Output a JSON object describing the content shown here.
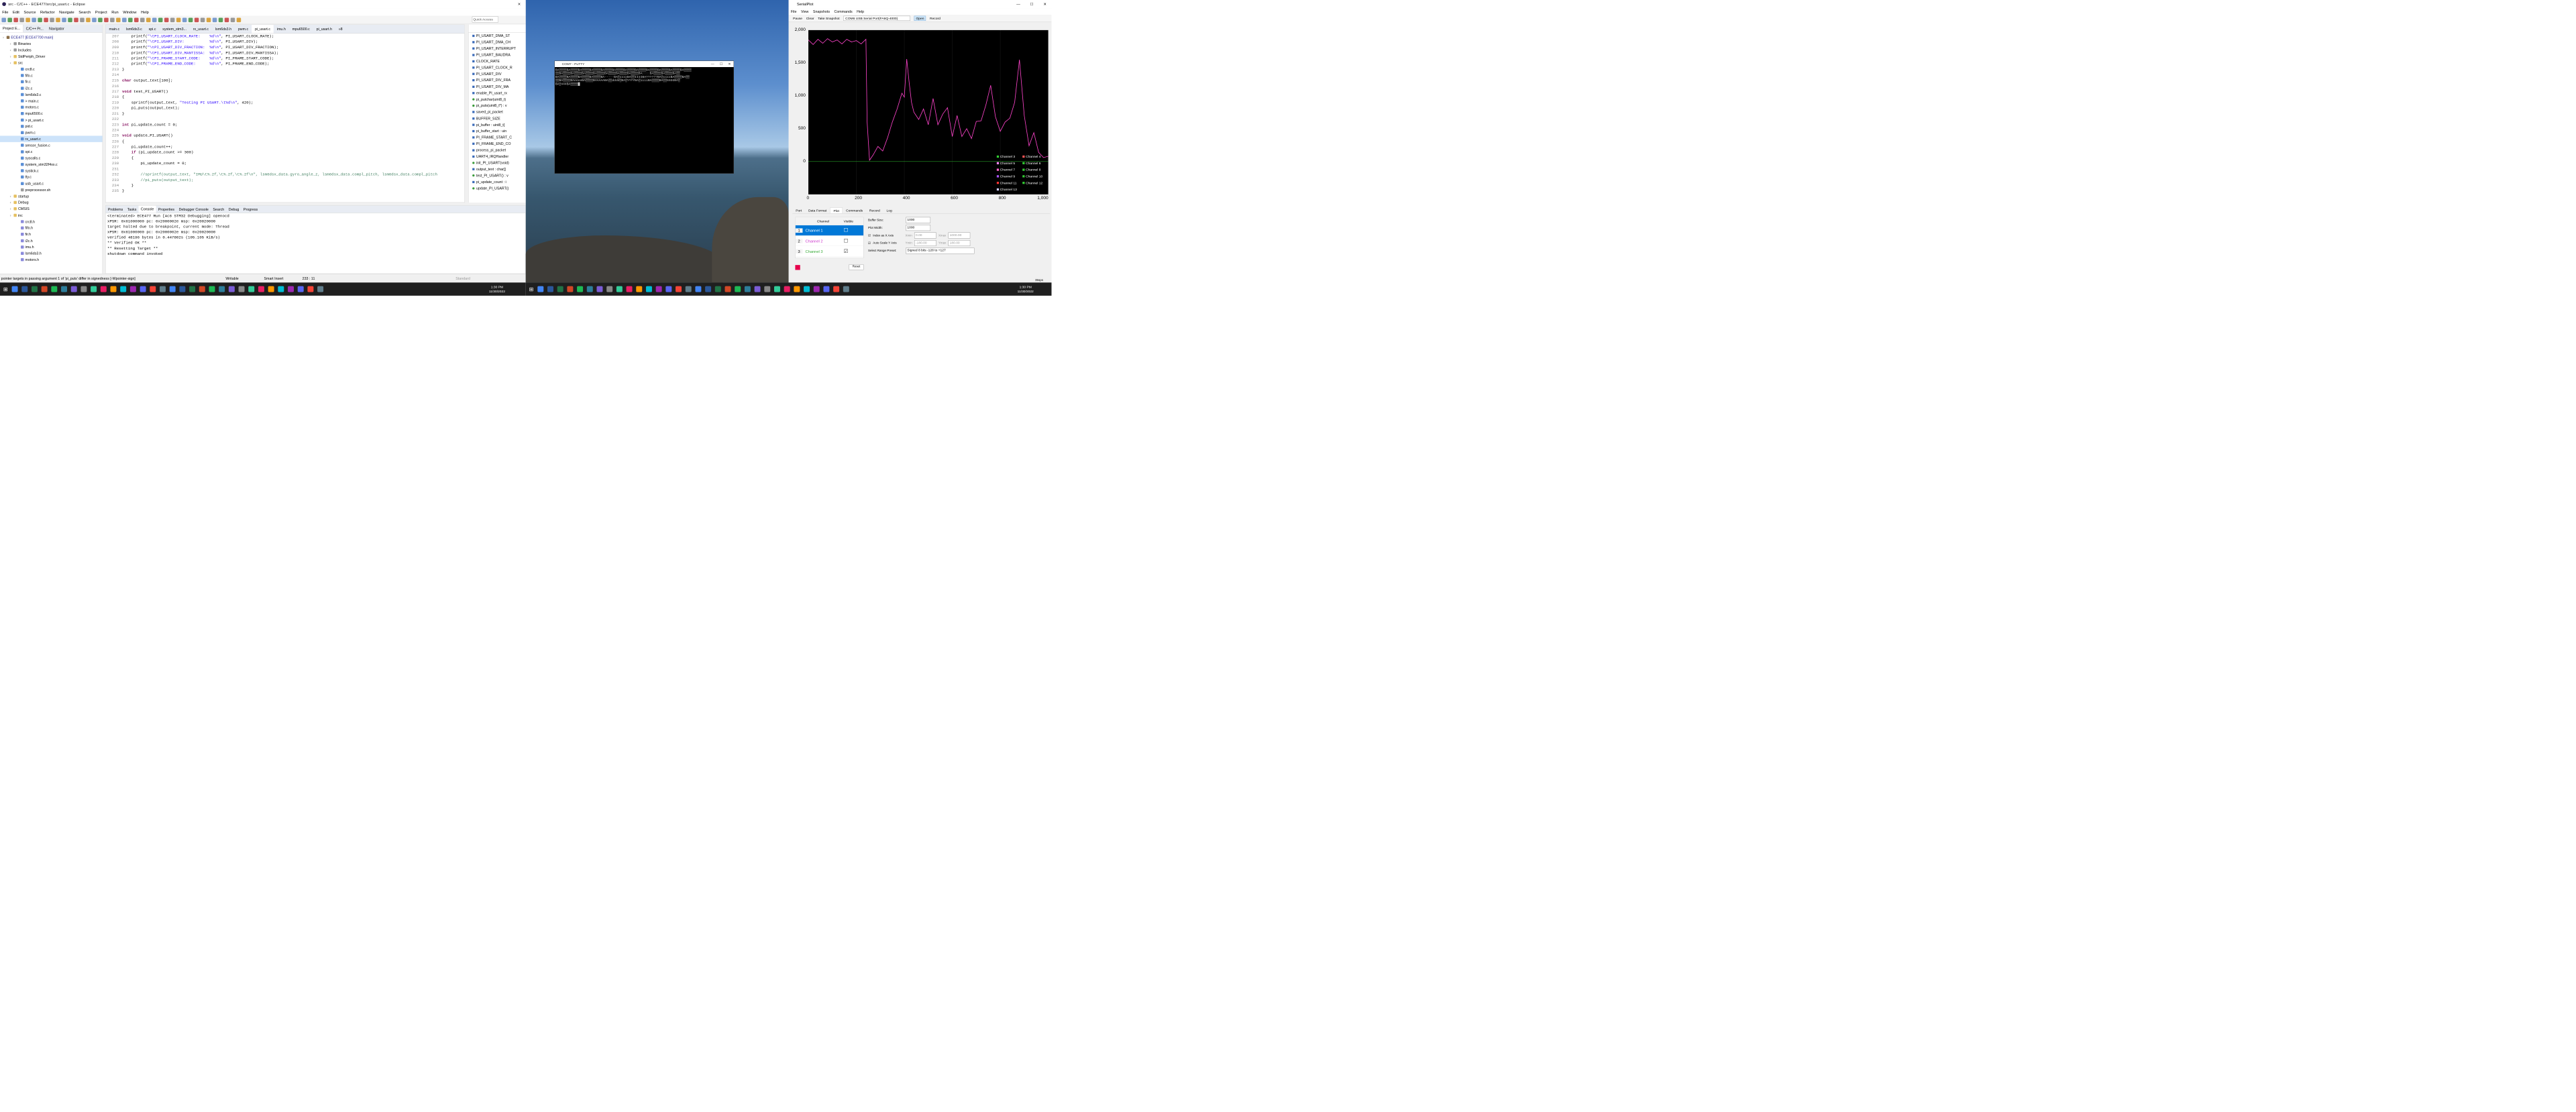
{
  "eclipse": {
    "title": "src - C/C++ - ECE477/src/pi_usart.c - Eclipse",
    "menu": [
      "File",
      "Edit",
      "Source",
      "Refactor",
      "Navigate",
      "Search",
      "Project",
      "Run",
      "Window",
      "Help"
    ],
    "quick_access": "Quick Access",
    "project_tabs": [
      "Project E...",
      "C/C++ Pr...",
      "Navigator"
    ],
    "tree": [
      {
        "label": "ECE477 [ECE47700 main]",
        "icon": "project-icon",
        "depth": 0,
        "color": "#1a1a8a"
      },
      {
        "label": "Binaries",
        "icon": "binaries-icon",
        "depth": 1
      },
      {
        "label": "Includes",
        "icon": "includes-icon",
        "depth": 1
      },
      {
        "label": "StdPeriph_Driver",
        "icon": "folder-icon",
        "depth": 1
      },
      {
        "label": "src",
        "icon": "folder-icon",
        "depth": 1
      },
      {
        "label": "crc8.c",
        "icon": "c-file-icon",
        "depth": 2
      },
      {
        "label": "fifo.c",
        "icon": "c-file-icon",
        "depth": 2
      },
      {
        "label": "fir.c",
        "icon": "c-file-icon",
        "depth": 2
      },
      {
        "label": "i2c.c",
        "icon": "c-file-icon",
        "depth": 2
      },
      {
        "label": "lsm6ds3.c",
        "icon": "c-file-icon",
        "depth": 2
      },
      {
        "label": "> main.c",
        "icon": "c-file-icon",
        "depth": 2
      },
      {
        "label": "motors.c",
        "icon": "c-file-icon",
        "depth": 2
      },
      {
        "label": "mpu6500.c",
        "icon": "c-file-icon",
        "depth": 2
      },
      {
        "label": "> pi_usart.c",
        "icon": "c-file-icon",
        "depth": 2
      },
      {
        "label": "pid.c",
        "icon": "c-file-icon",
        "depth": 2
      },
      {
        "label": "pwm.c",
        "icon": "c-file-icon",
        "depth": 2
      },
      {
        "label": "rx_usart.c",
        "icon": "c-file-icon",
        "depth": 2,
        "selected": true
      },
      {
        "label": "sensor_fusion.c",
        "icon": "c-file-icon",
        "depth": 2
      },
      {
        "label": "spi.c",
        "icon": "c-file-icon",
        "depth": 2
      },
      {
        "label": "syscalls.c",
        "icon": "c-file-icon",
        "depth": 2
      },
      {
        "label": "system_stm32f4xx.c",
        "icon": "c-file-icon",
        "depth": 2
      },
      {
        "label": "systick.c",
        "icon": "c-file-icon",
        "depth": 2
      },
      {
        "label": "tty.c",
        "icon": "c-file-icon",
        "depth": 2
      },
      {
        "label": "usb_usart.c",
        "icon": "c-file-icon",
        "depth": 2
      },
      {
        "label": "preprocessor.sh",
        "icon": "script-icon",
        "depth": 2
      },
      {
        "label": "startup",
        "icon": "folder-icon",
        "depth": 1
      },
      {
        "label": "Debug",
        "icon": "folder-icon",
        "depth": 1
      },
      {
        "label": "CMSIS",
        "icon": "folder-icon",
        "depth": 1
      },
      {
        "label": "inc",
        "icon": "folder-icon",
        "depth": 1
      },
      {
        "label": "crc8.h",
        "icon": "h-file-icon",
        "depth": 2
      },
      {
        "label": "fifo.h",
        "icon": "h-file-icon",
        "depth": 2
      },
      {
        "label": "fir.h",
        "icon": "h-file-icon",
        "depth": 2
      },
      {
        "label": "i2c.h",
        "icon": "h-file-icon",
        "depth": 2
      },
      {
        "label": "imu.h",
        "icon": "h-file-icon",
        "depth": 2
      },
      {
        "label": "lsm6ds3.h",
        "icon": "h-file-icon",
        "depth": 2
      },
      {
        "label": "motors.h",
        "icon": "h-file-icon",
        "depth": 2
      }
    ],
    "editor_tabs": [
      "main.c",
      "lsm6ds3.c",
      "spi.c",
      "system_stm3...",
      "rx_usart.c",
      "lsm6ds3.h",
      "pwm.c",
      "pi_usart.c",
      "imu.h",
      "mpu6500.c",
      "pi_usart.h",
      "»8"
    ],
    "active_tab": 7,
    "code": [
      {
        "n": "207",
        "t": "    printf(\"\\tPI_USART_CLOCK_RATE:    %d\\n\", PI_USART_CLOCK_RATE);"
      },
      {
        "n": "208",
        "t": "    printf(\"\\tPI_USART_DIV:           %d\\n\", PI_USART_DIV);"
      },
      {
        "n": "209",
        "t": "    printf(\"\\tPI_USART_DIV_FRACTION:  %d\\n\", PI_USART_DIV_FRACTION);"
      },
      {
        "n": "210",
        "t": "    printf(\"\\tPI_USART_DIV_MANTISSA:  %d\\n\", PI_USART_DIV_MANTISSA);"
      },
      {
        "n": "211",
        "t": "    printf(\"\\tPI_FRAME_START_CODE:    %d\\n\", PI_FRAME_START_CODE);"
      },
      {
        "n": "212",
        "t": "    printf(\"\\tPI_FRAME_END_CODE:      %d\\n\", PI_FRAME_END_CODE);"
      },
      {
        "n": "213",
        "t": "}"
      },
      {
        "n": "214",
        "t": ""
      },
      {
        "n": "215",
        "t": "char output_text[100];"
      },
      {
        "n": "216",
        "t": ""
      },
      {
        "n": "217",
        "t": "void test_PI_USART()"
      },
      {
        "n": "218",
        "t": "{"
      },
      {
        "n": "219",
        "t": "    sprintf(output_text, \"Testing PI USART.\\t%d\\n\", 420);"
      },
      {
        "n": "220",
        "t": "    pi_puts(output_text);"
      },
      {
        "n": "221",
        "t": "}"
      },
      {
        "n": "222",
        "t": ""
      },
      {
        "n": "223",
        "t": "int pi_update_count = 0;"
      },
      {
        "n": "224",
        "t": ""
      },
      {
        "n": "225",
        "t": "void update_PI_USART()"
      },
      {
        "n": "226",
        "t": "{"
      },
      {
        "n": "227",
        "t": "    pi_update_count++;"
      },
      {
        "n": "228",
        "t": "    if (pi_update_count >= 300)"
      },
      {
        "n": "229",
        "t": "    {"
      },
      {
        "n": "230",
        "t": "        pi_update_count = 0;"
      },
      {
        "n": "231",
        "t": ""
      },
      {
        "n": "232",
        "t": "        //sprintf(output_text, \"IMU\\t%.2f,\\t%.2f,\\t%.2f\\n\", lsm6dsx_data.gyro_angle_z, lsm6dsx_data.compl_pitch, lsm6dsx_data.compl_pitch"
      },
      {
        "n": "233",
        "t": "        //pi_puts(output_text);"
      },
      {
        "n": "234",
        "t": "    }"
      },
      {
        "n": "235",
        "t": "}"
      },
      {
        "n": "236",
        "t": ""
      }
    ],
    "outline": [
      "PI_USART_DMA_ST",
      "PI_USART_DMA_CH",
      "PI_USART_INTERRUPT",
      "PI_USART_BAUDRA",
      "CLOCK_RATE",
      "PI_USART_CLOCK_R",
      "PI_USART_DIV",
      "PI_USART_DIV_FRA",
      "PI_USART_DIV_MA",
      "enable_PI_usart_rx",
      "pi_putchar(uint8_t)",
      "pi_puts(uint8_t*) : v",
      "saved_pi_packet",
      "BUFFER_SIZE",
      "pi_buffer : uint8_t[",
      "pi_buffer_start : uin",
      "PI_FRAME_START_C",
      "PI_FRAME_END_CO",
      "process_pi_packet",
      "UART4_IRQHandler",
      "init_PI_USART(void)",
      "output_text : char[]",
      "test_PI_USART() : v",
      "pi_update_count : i",
      "update_PI_USART()"
    ],
    "console_tabs": [
      "Problems",
      "Tasks",
      "Console",
      "Properties",
      "Debugger Console",
      "Search",
      "Debug",
      "Progress"
    ],
    "console_active": 2,
    "console_lines": [
      "<terminated> ECE477 Run [Ac6 STM32 Debugging] openocd",
      "xPSR: 0x61000000 pc: 0x2000002e msp: 0x20020000",
      "target halted due to breakpoint, current mode: Thread",
      "xPSR: 0x61000000 pc: 0x2000002e msp: 0x20020000",
      "verified 48196 bytes in 0.447802s (105.105 KiB/s)",
      "** Verified OK **",
      "** Resetting Target **",
      "shutdown command invoked"
    ],
    "status": {
      "message": "pointer targets in passing argument 1 of 'pi_puts' differ in signedness [-Wpointer-sign]",
      "mode": "Writable",
      "insert": "Smart Insert",
      "pos": "233 : 11",
      "right": "Standard"
    }
  },
  "putty": {
    "title": "COM7 - PuTTY",
    "lines": [
      "BA▒▒▒▒BA▒▒▒▒BA▒▒▒▒BA▒▒▒▒BA▒▒▒▒BA▒▒▒▒BA▒▒▒▒BA▒▒▒▒BA▒▒▒▒BA▒▒▒▒BA▒▒▒▒BA▒▒▒▒",
      "▒▒BA▒▒▒▒BA▒▒▒▒BA▒▒▒▒BA▒▒▒▒BA▒▒▒▒BA▒▒▒▒BA▒▒▒▒BA::::BA▒▒▒▒BA▒▒▒▒BA▒▒",
      "BA▒▒▒▒BA▒▒▒▒BA▒▒▒▒BA▒▒▒▒BA-----BA▒xxxxBA▒▒IIIIBA??????BA▒xxxxBA▒▒▒▒BA▒▒",
      "▒▒BA▒▒▒▒BAeeeeBA▒▒▒▒BAAAAABA▒▒dddd▒BA▒YYYYBA▒iiiiBA▒▒▒▒BA▒▒GGGGBA▒",
      "BA▒444BA▒▒▒▒█"
    ]
  },
  "serialplot": {
    "title": "SerialPlot",
    "menu": [
      "File",
      "View",
      "Snapshots",
      "Commands",
      "Help"
    ],
    "toolbar": {
      "pause": "Pause",
      "clear": "Clear",
      "snapshot": "Take Snapshot",
      "port": "COM6 USB Serial Port(FA6Q-4000)",
      "open": "Open",
      "record": "Record"
    },
    "tabs": [
      "Port",
      "Data Format",
      "Plot",
      "Commands",
      "Record",
      "Log"
    ],
    "active_tab": 2,
    "channels": [
      {
        "num": "1",
        "name": "Channel 1",
        "color": "#ffffff",
        "visible": false,
        "selected": true
      },
      {
        "num": "2",
        "name": "Channel 2",
        "color": "#cc33cc",
        "visible": false,
        "selected": false
      },
      {
        "num": "3",
        "name": "Channel 3",
        "color": "#33aa33",
        "visible": true,
        "selected": false
      }
    ],
    "table_headers": [
      "Channel",
      "Visible"
    ],
    "opts": {
      "buffer_label": "Buffer Size:",
      "buffer": "1000",
      "width_label": "Plot Width:",
      "width": "1000",
      "index_label": "Index as X Axis",
      "xmin_label": "Xmin",
      "xmin": "0.00",
      "xmax_label": "Xmax",
      "xmax": "1000.00",
      "autoscale_label": "Auto Scale Y Axis",
      "ymin_label": "Ymin",
      "ymin": "-180.00",
      "ymax_label": "Ymax",
      "ymax": "180.00",
      "preset_label": "Select Range Preset:",
      "preset": "Signed 8 bits -128 to +127",
      "reset": "Reset"
    },
    "status_right": "35sps",
    "legend": [
      {
        "name": "Channel 3",
        "color": "#33cc33"
      },
      {
        "name": "Channel 4",
        "color": "#ff5555"
      },
      {
        "name": "Channel 5",
        "color": "#ff88ff"
      },
      {
        "name": "Channel 6",
        "color": "#33cc33"
      },
      {
        "name": "Channel 7",
        "color": "#ff66cc"
      },
      {
        "name": "Channel 8",
        "color": "#33cc33"
      },
      {
        "name": "Channel 9",
        "color": "#aa55ff"
      },
      {
        "name": "Channel 10",
        "color": "#33cc33"
      },
      {
        "name": "Channel 11",
        "color": "#ff3333"
      },
      {
        "name": "Channel 12",
        "color": "#33cc33"
      },
      {
        "name": "Channel 13",
        "color": "#ccccff"
      }
    ]
  },
  "chart_data": {
    "type": "line",
    "xlim": [
      0,
      1000
    ],
    "ylim": [
      -500,
      2000
    ],
    "xticks": [
      0,
      200,
      400,
      600,
      800,
      1000
    ],
    "yticks": [
      0,
      500,
      1000,
      1500,
      2000
    ],
    "xtick_labels": [
      "0",
      "200",
      "400",
      "600",
      "800",
      "1,000"
    ],
    "ytick_labels": [
      "0",
      "500",
      "1,000",
      "1,500",
      "2,000"
    ],
    "series": [
      {
        "color": "#ff44cc",
        "x": [
          0,
          20,
          40,
          60,
          80,
          100,
          120,
          140,
          160,
          180,
          200,
          220,
          240,
          245,
          255,
          270,
          290,
          310,
          330,
          350,
          370,
          390,
          400,
          410,
          420,
          430,
          440,
          460,
          480,
          500,
          520,
          540,
          560,
          580,
          600,
          620,
          640,
          660,
          680,
          700,
          720,
          740,
          760,
          780,
          800,
          820,
          840,
          860,
          880,
          900,
          920,
          940,
          960,
          980,
          1000
        ],
        "y": [
          1850,
          1780,
          1860,
          1800,
          1870,
          1820,
          1850,
          1790,
          1860,
          1820,
          1840,
          1790,
          1860,
          600,
          20,
          100,
          230,
          160,
          360,
          600,
          800,
          1040,
          980,
          1560,
          1210,
          900,
          750,
          640,
          800,
          560,
          960,
          560,
          720,
          820,
          380,
          700,
          380,
          500,
          350,
          610,
          620,
          860,
          1160,
          680,
          460,
          600,
          660,
          900,
          1550,
          700,
          240,
          440,
          140,
          60,
          80
        ]
      },
      {
        "color": "#33cc33",
        "x": [
          0,
          1000
        ],
        "y": [
          0,
          0
        ]
      }
    ]
  },
  "desktop": {
    "clock_time": "1:30 PM",
    "clock_date": "11/30/2022"
  }
}
